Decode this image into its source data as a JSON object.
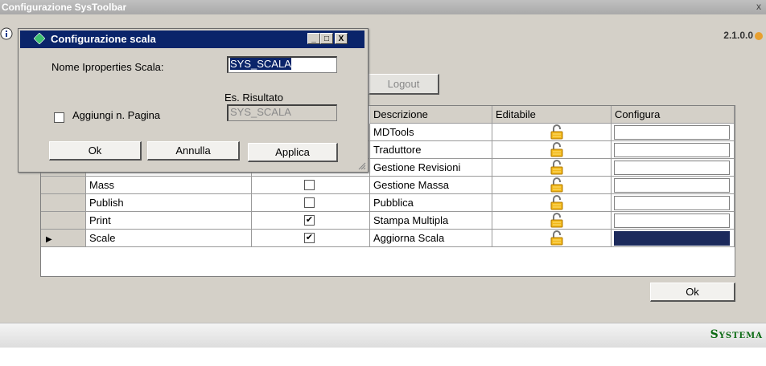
{
  "main_window": {
    "title": "Configurazione SysToolbar",
    "close_glyph": "x",
    "version": "2.1.0.0",
    "brand": "Systema",
    "logout_label": "Logout",
    "ok_label": "Ok"
  },
  "grid": {
    "columns": {
      "descrizione": "Descrizione",
      "editabile": "Editabile",
      "configura": "Configura"
    },
    "rows": [
      {
        "name": "",
        "checked": false,
        "descrizione": "MDTools",
        "editable_icon": "lock-open-icon",
        "selected": false
      },
      {
        "name": "",
        "checked": false,
        "descrizione": "Traduttore",
        "editable_icon": "lock-open-icon",
        "selected": false
      },
      {
        "name": "",
        "checked": false,
        "descrizione": "Gestione Revisioni",
        "editable_icon": "lock-open-icon",
        "selected": false
      },
      {
        "name": "Mass",
        "checked": false,
        "descrizione": "Gestione Massa",
        "editable_icon": "lock-open-icon",
        "selected": false
      },
      {
        "name": "Publish",
        "checked": false,
        "descrizione": "Pubblica",
        "editable_icon": "lock-open-icon",
        "selected": false
      },
      {
        "name": "Print",
        "checked": true,
        "descrizione": "Stampa Multipla",
        "editable_icon": "lock-open-icon",
        "selected": false
      },
      {
        "name": "Scale",
        "checked": true,
        "descrizione": "Aggiorna Scala",
        "editable_icon": "lock-open-icon",
        "selected": true
      }
    ],
    "current_row_marker": "▶"
  },
  "dialog": {
    "title": "Configurazione scala",
    "minimize_glyph": "_",
    "maximize_glyph": "□",
    "close_glyph": "X",
    "nome_label": "Nome Iproperties Scala:",
    "nome_value": "SYS_SCALA",
    "risultato_label": "Es. Risultato",
    "risultato_value": "SYS_SCALA",
    "aggiungi_label": "Aggiungi n. Pagina",
    "aggiungi_checked": false,
    "ok_label": "Ok",
    "annulla_label": "Annulla",
    "applica_label": "Applica"
  },
  "colors": {
    "title_bar_active": "#0a246a",
    "brand": "#0a6a12",
    "selected_cell": "#1c2a5c"
  }
}
